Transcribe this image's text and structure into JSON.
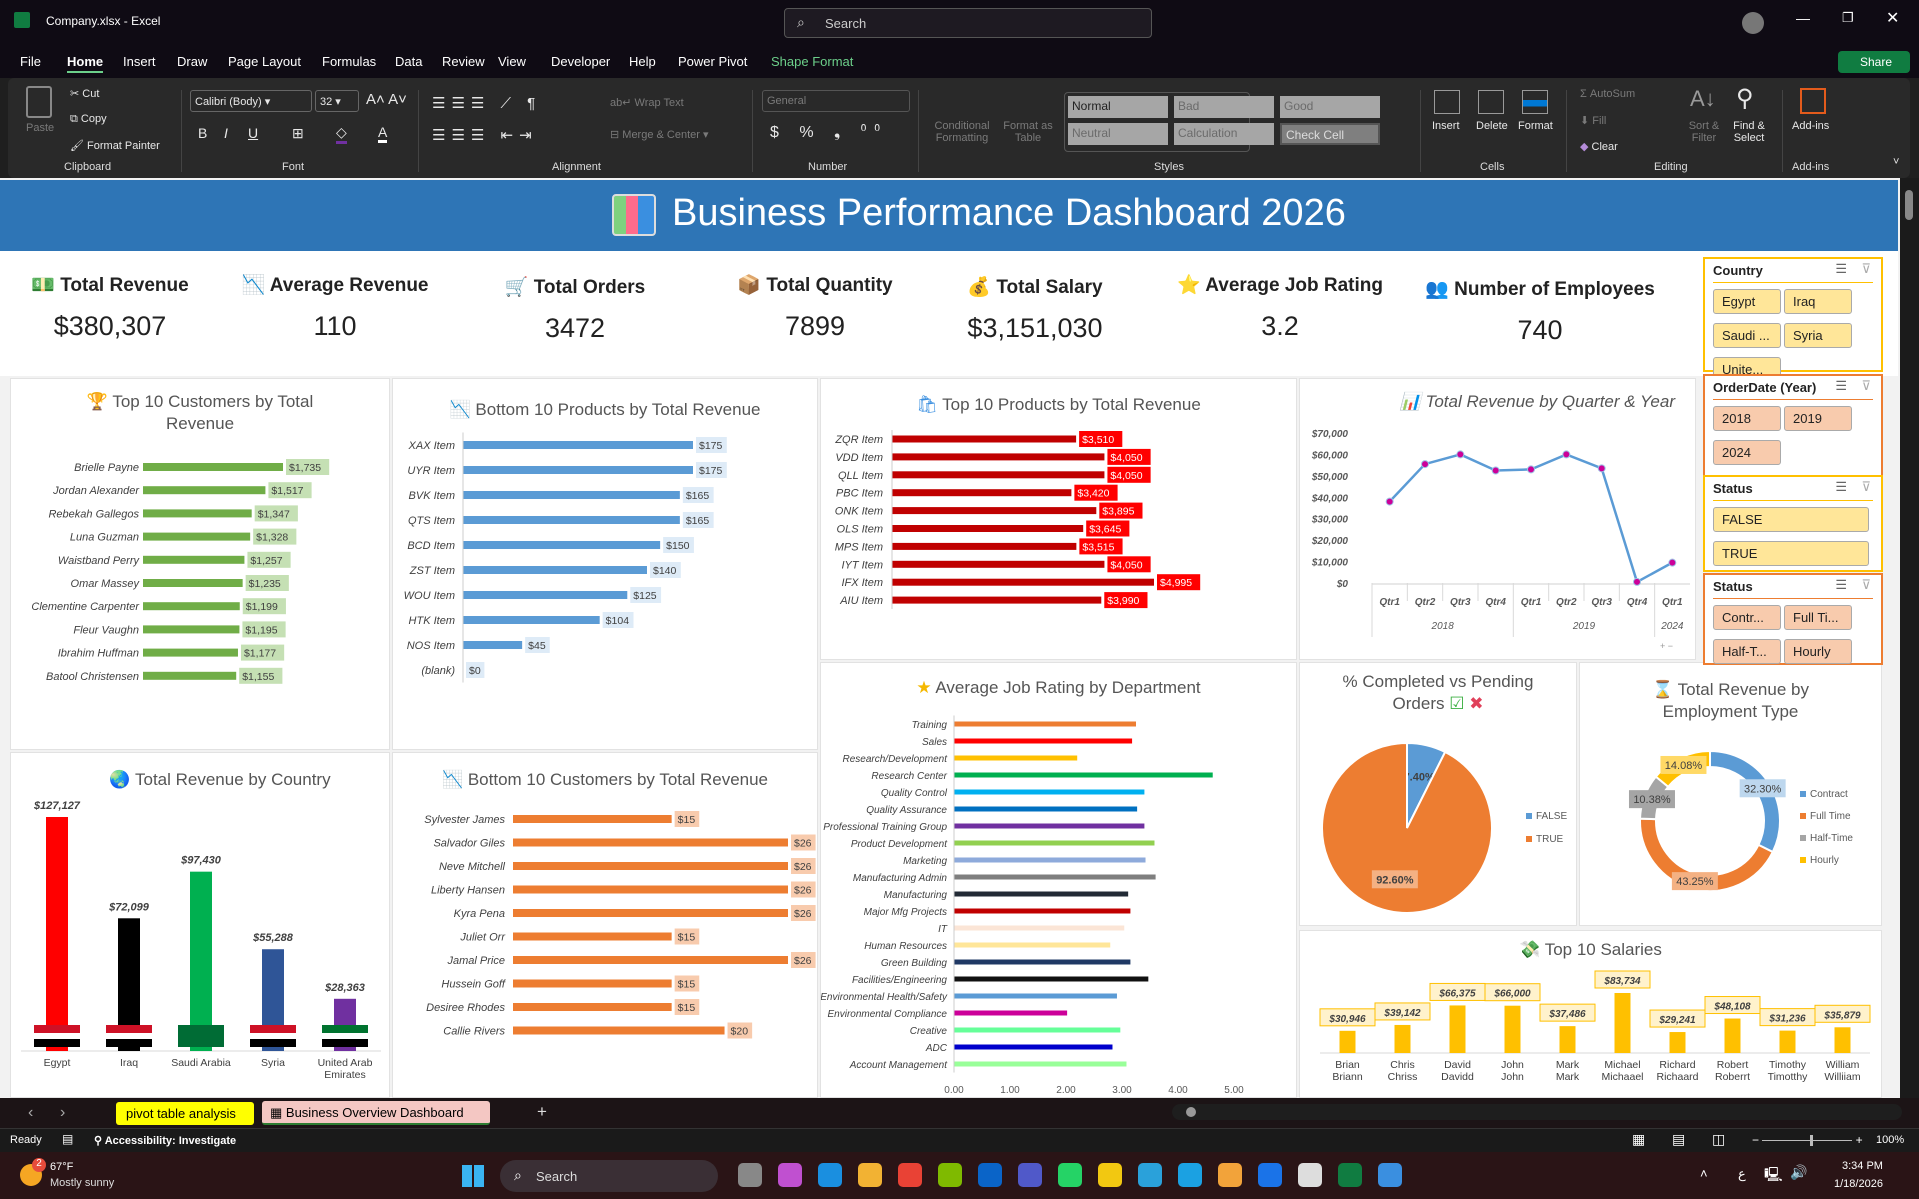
{
  "window": {
    "title": "Company.xlsx  -  Excel",
    "search_placeholder": "Search"
  },
  "menu": {
    "items": [
      "File",
      "Home",
      "Insert",
      "Draw",
      "Page Layout",
      "Formulas",
      "Data",
      "Review",
      "View",
      "Developer",
      "Help",
      "Power Pivot",
      "Shape Format"
    ],
    "active": "Home",
    "share": "Share"
  },
  "ribbon": {
    "clipboard": {
      "paste": "Paste",
      "cut": "Cut",
      "copy": "Copy",
      "format_painter": "Format Painter",
      "group": "Clipboard"
    },
    "font": {
      "name": "Calibri (Body)",
      "size": "32",
      "group": "Font"
    },
    "alignment": {
      "wrap": "Wrap Text",
      "merge": "Merge & Center",
      "group": "Alignment"
    },
    "number": {
      "format": "General",
      "group": "Number"
    },
    "styles": {
      "conditional": "Conditional Formatting",
      "format_table": "Format as Table",
      "cells": [
        "Normal",
        "Bad",
        "Good",
        "Neutral",
        "Calculation",
        "Check Cell"
      ],
      "group": "Styles"
    },
    "cells": {
      "insert": "Insert",
      "delete": "Delete",
      "format": "Format",
      "group": "Cells"
    },
    "editing": {
      "autosum": "AutoSum",
      "fill": "Fill",
      "clear": "Clear",
      "sort": "Sort & Filter",
      "find": "Find & Select",
      "group": "Editing"
    },
    "addins": {
      "label": "Add-ins",
      "group": "Add-ins"
    }
  },
  "dashboard": {
    "title": "Business Performance Dashboard 2026",
    "kpis": [
      {
        "label": "Total Revenue",
        "value": "$380,307",
        "icon": "money-icon"
      },
      {
        "label": "Average Revenue",
        "value": "110",
        "icon": "chart-down-icon"
      },
      {
        "label": "Total Orders",
        "value": "3472",
        "icon": "cart-icon"
      },
      {
        "label": "Total Quantity",
        "value": "7899",
        "icon": "package-icon"
      },
      {
        "label": "Total Salary",
        "value": "$3,151,030",
        "icon": "money-bag-icon"
      },
      {
        "label": "Average Job Rating",
        "value": "3.2",
        "icon": "star-icon"
      },
      {
        "label": "Number of Employees",
        "value": "740",
        "icon": "people-icon"
      }
    ]
  },
  "slicers": [
    {
      "title": "Country",
      "items": [
        "Egypt",
        "Iraq",
        "Saudi ...",
        "Syria",
        "Unite..."
      ],
      "color": "#ffe699"
    },
    {
      "title": "OrderDate (Year)",
      "items": [
        "2018",
        "2019",
        "2024"
      ],
      "color": "#f8cbad"
    },
    {
      "title": "Status",
      "items": [
        "FALSE",
        "TRUE"
      ],
      "color": "#ffe699"
    },
    {
      "title": "Status",
      "items": [
        "Contr...",
        "Full Ti...",
        "Half-T...",
        "Hourly"
      ],
      "color": "#f8cbad"
    }
  ],
  "chart_data": [
    {
      "id": "top-customers",
      "type": "bar",
      "orientation": "horizontal",
      "title": "Top 10 Customers by Total Revenue",
      "color": "#70ad47",
      "label_bg": "#c5e0b4",
      "categories": [
        "Brielle Payne",
        "Jordan Alexander",
        "Rebekah Gallegos",
        "Luna Guzman",
        "Waistband Perry",
        "Omar Massey",
        "Clementine Carpenter",
        "Fleur Vaughn",
        "Ibrahim Huffman",
        "Batool Christensen"
      ],
      "values": [
        1735,
        1517,
        1347,
        1328,
        1257,
        1235,
        1199,
        1195,
        1177,
        1155
      ],
      "labels": [
        "$1,735",
        "$1,517",
        "$1,347",
        "$1,328",
        "$1,257",
        "$1,235",
        "$1,199",
        "$1,195",
        "$1,177",
        "$1,155"
      ]
    },
    {
      "id": "bottom-products",
      "type": "bar",
      "orientation": "horizontal",
      "title": "Bottom 10 Products by Total Revenue",
      "color": "#5b9bd5",
      "label_bg": "#deebf7",
      "categories": [
        "XAX Item",
        "UYR Item",
        "BVK Item",
        "QTS Item",
        "BCD Item",
        "ZST Item",
        "WOU Item",
        "HTK Item",
        "NOS Item",
        "(blank)"
      ],
      "values": [
        175,
        175,
        165,
        165,
        150,
        140,
        125,
        104,
        45,
        0
      ],
      "labels": [
        "$175",
        "$175",
        "$165",
        "$165",
        "$150",
        "$140",
        "$125",
        "$104",
        "$45",
        "$0"
      ]
    },
    {
      "id": "top-products",
      "type": "bar",
      "orientation": "horizontal",
      "title": "Top 10 Products by Total Revenue",
      "color": "#c00000",
      "label_bg": "#ff0000",
      "categories": [
        "ZQR Item",
        "VDD Item",
        "QLL Item",
        "PBC Item",
        "ONK Item",
        "OLS Item",
        "MPS Item",
        "IYT Item",
        "IFX Item",
        "AIU Item"
      ],
      "values": [
        3510,
        4050,
        4050,
        3420,
        3895,
        3645,
        3515,
        4050,
        4995,
        3990
      ],
      "labels": [
        "$3,510",
        "$4,050",
        "$4,050",
        "$3,420",
        "$3,895",
        "$3,645",
        "$3,515",
        "$4,050",
        "$4,995",
        "$3,990"
      ]
    },
    {
      "id": "quarterly",
      "type": "line",
      "title": "Total Revenue by Quarter & Year",
      "color": "#5b9bd5",
      "marker_color": "#cc0099",
      "x": [
        "Qtr1",
        "Qtr2",
        "Qtr3",
        "Qtr4",
        "Qtr1",
        "Qtr2",
        "Qtr3",
        "Qtr4",
        "Qtr1"
      ],
      "groups": [
        {
          "label": "2018",
          "span": 4
        },
        {
          "label": "2019",
          "span": 4
        },
        {
          "label": "2024",
          "span": 1
        }
      ],
      "values": [
        38000,
        55500,
        60000,
        52500,
        53000,
        60000,
        53500,
        500,
        9500
      ],
      "ylim": [
        0,
        70000
      ],
      "yticks": [
        "$0",
        "$10,000",
        "$20,000",
        "$30,000",
        "$40,000",
        "$50,000",
        "$60,000",
        "$70,000"
      ]
    },
    {
      "id": "country",
      "type": "bar",
      "orientation": "vertical",
      "title": "Total Revenue by Country",
      "categories": [
        "Egypt",
        "Iraq",
        "Saudi Arabia",
        "Syria",
        "United Arab Emirates"
      ],
      "values": [
        127127,
        72099,
        97430,
        55288,
        28363
      ],
      "labels": [
        "$127,127",
        "$72,099",
        "$97,430",
        "$55,288",
        "$28,363"
      ],
      "colors": [
        "#ff0000",
        "#000000",
        "#00b050",
        "#2f5597",
        "#7030a0"
      ]
    },
    {
      "id": "bottom-customers",
      "type": "bar",
      "orientation": "horizontal",
      "title": "Bottom 10 Customers by Total Revenue",
      "color": "#ed7d31",
      "label_bg": "#f8cbad",
      "categories": [
        "Sylvester James",
        "Salvador Giles",
        "Neve Mitchell",
        "Liberty Hansen",
        "Kyra Pena",
        "Juliet Orr",
        "Jamal Price",
        "Hussein Goff",
        "Desiree Rhodes",
        "Callie Rivers"
      ],
      "values": [
        15,
        26,
        26,
        26,
        26,
        15,
        26,
        15,
        15,
        20
      ],
      "labels": [
        "$15",
        "$26",
        "$26",
        "$26",
        "$26",
        "$15",
        "$26",
        "$15",
        "$15",
        "$20"
      ]
    },
    {
      "id": "job-rating",
      "type": "bar",
      "orientation": "horizontal",
      "title": "Average Job Rating by Department",
      "xlim": [
        0,
        5
      ],
      "xticks": [
        "0.00",
        "1.00",
        "2.00",
        "3.00",
        "4.00",
        "5.00"
      ],
      "categories": [
        "Training",
        "Sales",
        "Research/Development",
        "Research Center",
        "Quality Control",
        "Quality Assurance",
        "Professional Training Group",
        "Product Development",
        "Marketing",
        "Manufacturing Admin",
        "Manufacturing",
        "Major Mfg Projects",
        "IT",
        "Human Resources",
        "Green Building",
        "Facilities/Engineering",
        "Environmental Health/Safety",
        "Environmental Compliance",
        "Creative",
        "ADC",
        "Account Management"
      ],
      "values": [
        3.25,
        3.18,
        2.2,
        4.62,
        3.4,
        3.27,
        3.4,
        3.58,
        3.42,
        3.6,
        3.11,
        3.15,
        3.04,
        2.79,
        3.15,
        3.47,
        2.91,
        2.02,
        2.97,
        2.83,
        3.08
      ],
      "colors": [
        "#ed7d31",
        "#ff0000",
        "#ffc000",
        "#00b050",
        "#00b0f0",
        "#0070c0",
        "#7030a0",
        "#92d050",
        "#8eaadb",
        "#7f7f7f",
        "#222a35",
        "#c00000",
        "#fbe5d6",
        "#ffe699",
        "#1f3864",
        "#111111",
        "#5b9bd5",
        "#cc0099",
        "#66ff99",
        "#0000cc",
        "#99ff99"
      ]
    },
    {
      "id": "completed",
      "type": "pie",
      "title": "% Completed vs Pending Orders",
      "categories": [
        "FALSE",
        "TRUE"
      ],
      "values": [
        7.4,
        92.6
      ],
      "labels": [
        "7.40%",
        "92.60%"
      ],
      "colors": [
        "#5b9bd5",
        "#ed7d31"
      ],
      "legend": "right"
    },
    {
      "id": "employment",
      "type": "pie",
      "donut": true,
      "title": "Total Revenue by Employment Type",
      "categories": [
        "Contract",
        "Full Time",
        "Half-Time",
        "Hourly"
      ],
      "values": [
        32.3,
        43.25,
        10.38,
        14.08
      ],
      "labels": [
        "32.30%",
        "43.25%",
        "10.38%",
        "14.08%"
      ],
      "colors": [
        "#5b9bd5",
        "#ed7d31",
        "#a5a5a5",
        "#ffc000"
      ],
      "legend": "right"
    },
    {
      "id": "salaries",
      "type": "bar",
      "orientation": "vertical",
      "title": "Top 10 Salaries",
      "color": "#ffc000",
      "categories": [
        "Brian Briann",
        "Chris Chriss",
        "David Davidd",
        "John John",
        "Mark Mark",
        "Michael Michaael",
        "Richard Richaard",
        "Robert Roberrt",
        "Timothy Timotthy",
        "William Williiam"
      ],
      "values": [
        30946,
        39142,
        66375,
        66000,
        37486,
        83734,
        29241,
        48108,
        31236,
        35879
      ],
      "labels": [
        "$30,946",
        "$39,142",
        "$66,375",
        "$66,000",
        "$37,486",
        "$83,734",
        "$29,241",
        "$48,108",
        "$31,236",
        "$35,879"
      ]
    }
  ],
  "sheet_tabs": [
    "pivot table analysis",
    "Business Overview Dashboard"
  ],
  "status": {
    "ready": "Ready",
    "accessibility": "Accessibility: Investigate",
    "zoom": "100%"
  },
  "taskbar": {
    "temp": "67°F",
    "weather": "Mostly sunny",
    "badge": "2",
    "search": "Search",
    "time": "3:34 PM",
    "date": "1/18/2026",
    "lang": "ع"
  }
}
